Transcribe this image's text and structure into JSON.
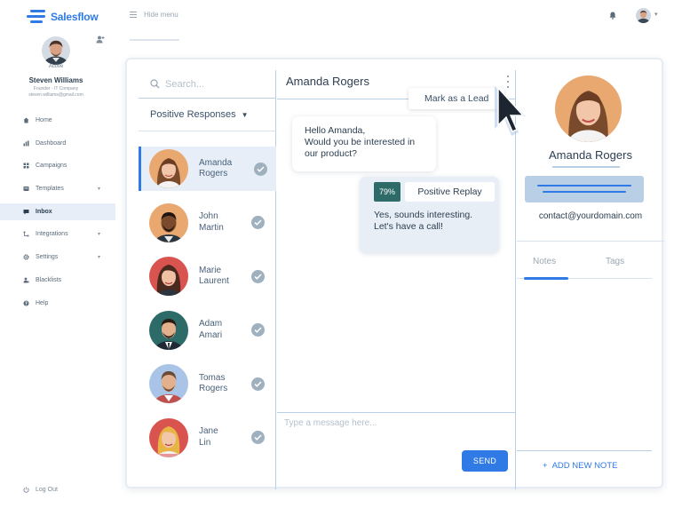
{
  "app": {
    "brand": "Salesflow",
    "hide_menu_label": "Hide menu"
  },
  "user": {
    "status": "Active",
    "name": "Steven Williams",
    "role": "Founder - IT Company",
    "email": "steven.williams@gmail.com"
  },
  "nav": {
    "items": [
      {
        "label": "Home",
        "icon": "home-icon",
        "active": false,
        "caret": false
      },
      {
        "label": "Dashboard",
        "icon": "chart-icon",
        "active": false,
        "caret": false
      },
      {
        "label": "Campaigns",
        "icon": "grid-icon",
        "active": false,
        "caret": false
      },
      {
        "label": "Templates",
        "icon": "template-icon",
        "active": false,
        "caret": true
      },
      {
        "label": "Inbox",
        "icon": "inbox-icon",
        "active": true,
        "caret": false
      },
      {
        "label": "Integrations",
        "icon": "integration-icon",
        "active": false,
        "caret": true
      },
      {
        "label": "Settings",
        "icon": "gear-icon",
        "active": false,
        "caret": true
      },
      {
        "label": "Blacklists",
        "icon": "blacklist-icon",
        "active": false,
        "caret": false
      },
      {
        "label": "Help",
        "icon": "help-icon",
        "active": false,
        "caret": false
      }
    ],
    "logout_label": "Log Out"
  },
  "inbox": {
    "search_placeholder": "Search...",
    "filter_label": "Positive Responses",
    "contacts": [
      {
        "first": "Amanda",
        "last": "Rogers",
        "selected": true
      },
      {
        "first": "John",
        "last": "Martin",
        "selected": false
      },
      {
        "first": "Marie",
        "last": "Laurent",
        "selected": false
      },
      {
        "first": "Adam",
        "last": "Amari",
        "selected": false
      },
      {
        "first": "Tomas",
        "last": "Rogers",
        "selected": false
      },
      {
        "first": "Jane",
        "last": "Lin",
        "selected": false
      }
    ]
  },
  "conversation": {
    "title": "Amanda Rogers",
    "mark_lead_label": "Mark as a Lead",
    "incoming_lines": [
      "Hello Amanda,",
      "Would you be interested in",
      "our product?"
    ],
    "reply": {
      "score": "79%",
      "sentiment": "Positive Replay",
      "lines": [
        "Yes, sounds interesting.",
        "Let's have a call!"
      ]
    },
    "composer_placeholder": "Type a message here...",
    "send_label": "SEND"
  },
  "profile": {
    "name": "Amanda Rogers",
    "email": "contact@yourdomain.com",
    "tabs": [
      "Notes",
      "Tags"
    ],
    "add_note_label": "ADD NEW NOTE"
  },
  "colors": {
    "accent": "#2f7ae5",
    "score_bg": "#2d6b68",
    "panel_bg": "#e7eef7",
    "divider": "#b9cfe6"
  }
}
